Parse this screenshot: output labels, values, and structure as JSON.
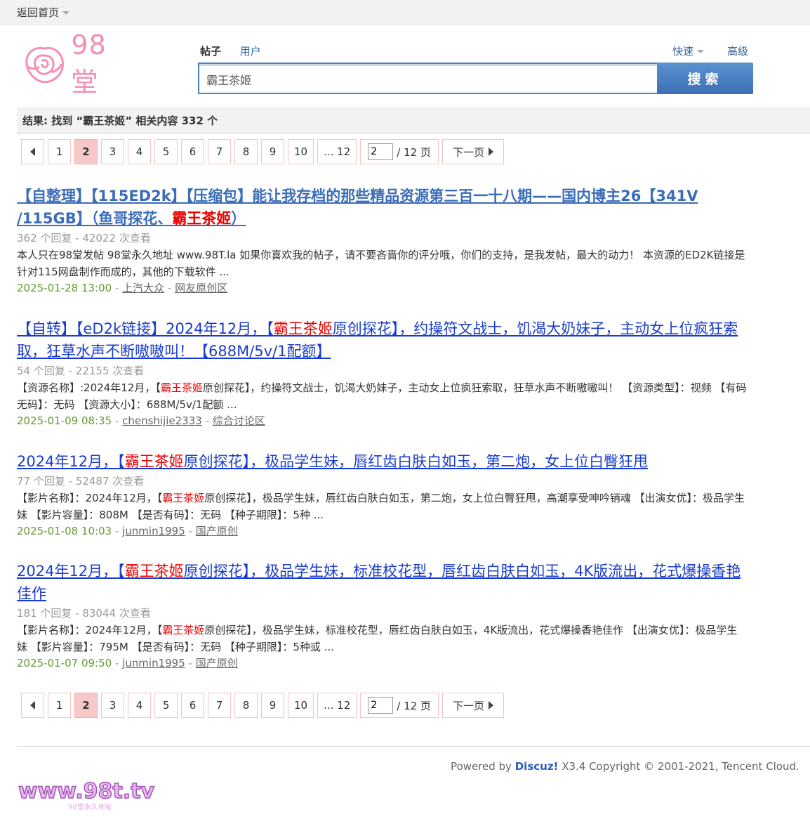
{
  "topbar": {
    "home_label": "返回首页"
  },
  "logo": {
    "text": "98堂"
  },
  "search": {
    "tab_posts": "帖子",
    "tab_users": "用户",
    "quick_label": "快速",
    "advanced_label": "高级",
    "query": "霸王茶姬",
    "button_label": "搜索"
  },
  "result_summary": "结果: 找到 “霸王茶姬” 相关内容 332 个",
  "pager": {
    "pages": [
      "1",
      "2",
      "3",
      "4",
      "5",
      "6",
      "7",
      "8",
      "9",
      "10",
      "... 12"
    ],
    "current": "2",
    "jump_value": "2",
    "total_label": "/ 12 页",
    "next_label": "下一页"
  },
  "results": [
    {
      "title_a": "【自整理】【115ED2k】【压缩包】能让我存档的那些精品资源第三百一十八期——国内博主26【341V /115GB】（鱼哥探花、",
      "title_hl": "霸王茶姬",
      "title_b": "）",
      "meta": "362 个回复 - 42022 次查看",
      "desc_a": "本人只在98堂发帖 98堂永久地址 www.98T.la 如果你喜欢我的帖子，请不要吝啬你的评分哦，你们的支持，是我发帖，最大的动力！ 本资源的ED2K链接是针对115网盘制作而成的，其他的下载软件 ...",
      "desc_hl": "",
      "desc_b": "",
      "date": "2025-01-28 13:00",
      "author": "上汽大众",
      "forum": "网友原创区"
    },
    {
      "title_a": "【自转】【eD2k链接】2024年12月，【",
      "title_hl": "霸王茶姬",
      "title_b": "原创探花】，约操符文战士，饥渴大奶妹子，主动女上位疯狂索取，狂草水声不断嗷嗷叫！【688M/5v/1配额】",
      "meta": "54 个回复 - 22155 次查看",
      "desc_a": "【资源名称】:2024年12月，【",
      "desc_hl": "霸王茶姬",
      "desc_b": "原创探花】，约操符文战士，饥渴大奶妹子，主动女上位疯狂索取，狂草水声不断嗷嗷叫！ 【资源类型】：视频 【有码无码】：无码 【资源大小】：688M/5v/1配额 ...",
      "date": "2025-01-09 08:35",
      "author": "chenshijie2333",
      "forum": "综合讨论区"
    },
    {
      "title_a": "2024年12月，【",
      "title_hl": "霸王茶姬",
      "title_b": "原创探花】，极品学生妹，唇红齿白肤白如玉，第二炮，女上位白臀狂甩",
      "meta": "77 个回复 - 52487 次查看",
      "desc_a": "【影片名称】：2024年12月，【",
      "desc_hl": "霸王茶姬",
      "desc_b": "原创探花】，极品学生妹，唇红齿白肤白如玉，第二炮，女上位白臀狂甩，高潮享受呻吟销魂 【出演女优】：极品学生妹 【影片容量】：808M 【是否有码】：无码 【种子期限】：5种 ...",
      "date": "2025-01-08 10:03",
      "author": "junmin1995",
      "forum": "国产原创"
    },
    {
      "title_a": "2024年12月，【",
      "title_hl": "霸王茶姬",
      "title_b": "原创探花】，极品学生妹，标准校花型，唇红齿白肤白如玉，4K版流出，花式爆操香艳佳作",
      "meta": "181 个回复 - 83044 次查看",
      "desc_a": "【影片名称】：2024年12月，【",
      "desc_hl": "霸王茶姬",
      "desc_b": "原创探花】，极品学生妹，标准校花型，唇红齿白肤白如玉，4K版流出，花式爆操香艳佳作 【出演女优】：极品学生妹 【影片容量】：795M 【是否有码】：无码 【种子期限】：5种或 ...",
      "date": "2025-01-07 09:50",
      "author": "junmin1995",
      "forum": "国产原创"
    }
  ],
  "footer": {
    "powered_prefix": "Powered by",
    "powered_brand": "Discuz!",
    "powered_rest": "X3.4   Copyright © 2001-2021, Tencent Cloud.",
    "logo_text": "www.98t.tv",
    "logo_sub": "98堂永久地址"
  }
}
